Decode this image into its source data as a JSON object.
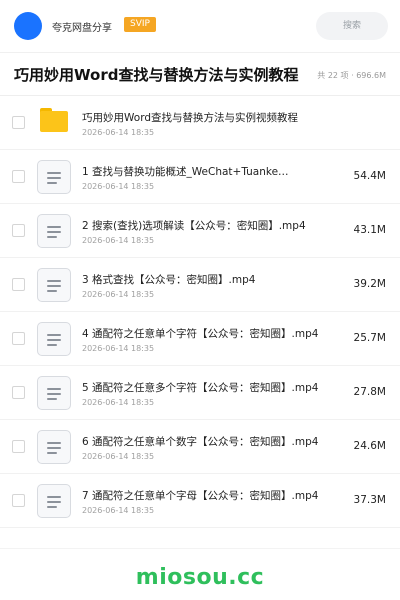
{
  "header": {
    "brand": "夸克网盘分享",
    "badge": "SVIP",
    "search_placeholder": "搜索"
  },
  "folder": {
    "title": "巧用妙用Word查找与替换方法与实例教程",
    "stats": "共 22 项 · 696.6M"
  },
  "items": [
    {
      "name": "巧用妙用Word查找与替换方法与实例视频教程",
      "date": "2026-06-14 18:35",
      "size": "",
      "type": "folder"
    },
    {
      "name": "1 查找与替换功能概述_WeChat+Tuanke…",
      "date": "2026-06-14 18:35",
      "size": "54.4M",
      "type": "file"
    },
    {
      "name": "2 搜索(查找)选项解读【公众号：密知圈】.mp4",
      "date": "2026-06-14 18:35",
      "size": "43.1M",
      "type": "file"
    },
    {
      "name": "3 格式查找【公众号：密知圈】.mp4",
      "date": "2026-06-14 18:35",
      "size": "39.2M",
      "type": "file"
    },
    {
      "name": "4 通配符之任意单个字符【公众号：密知圈】.mp4",
      "date": "2026-06-14 18:35",
      "size": "25.7M",
      "type": "file"
    },
    {
      "name": "5 通配符之任意多个字符【公众号：密知圈】.mp4",
      "date": "2026-06-14 18:35",
      "size": "27.8M",
      "type": "file"
    },
    {
      "name": "6 通配符之任意单个数字【公众号：密知圈】.mp4",
      "date": "2026-06-14 18:35",
      "size": "24.6M",
      "type": "file"
    },
    {
      "name": "7 通配符之任意单个字母【公众号：密知圈】.mp4",
      "date": "2026-06-14 18:35",
      "size": "37.3M",
      "type": "file"
    }
  ],
  "watermark": "miosou.cc",
  "colors": {
    "accent": "#1a73ff",
    "badge": "#f5a623",
    "folder": "#fcc419",
    "watermark": "#2fbf5c"
  }
}
